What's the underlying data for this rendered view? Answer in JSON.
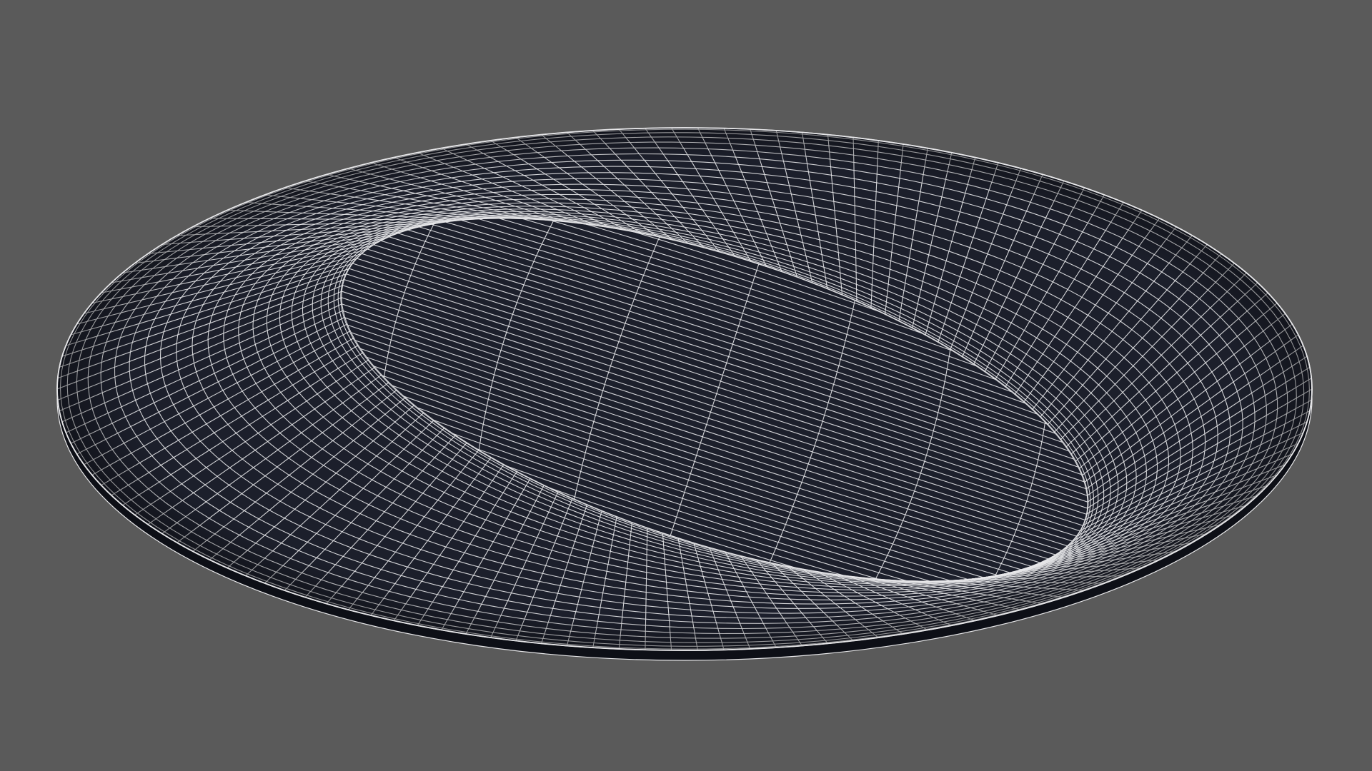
{
  "scene": {
    "background_color": "#5a5a5a",
    "object": {
      "name": "plate",
      "render_style": "wireframe",
      "surface_color": "#1c1f2b",
      "wire_color": "#e8e8ea",
      "rim_shadow_color": "#0d0f16"
    }
  }
}
